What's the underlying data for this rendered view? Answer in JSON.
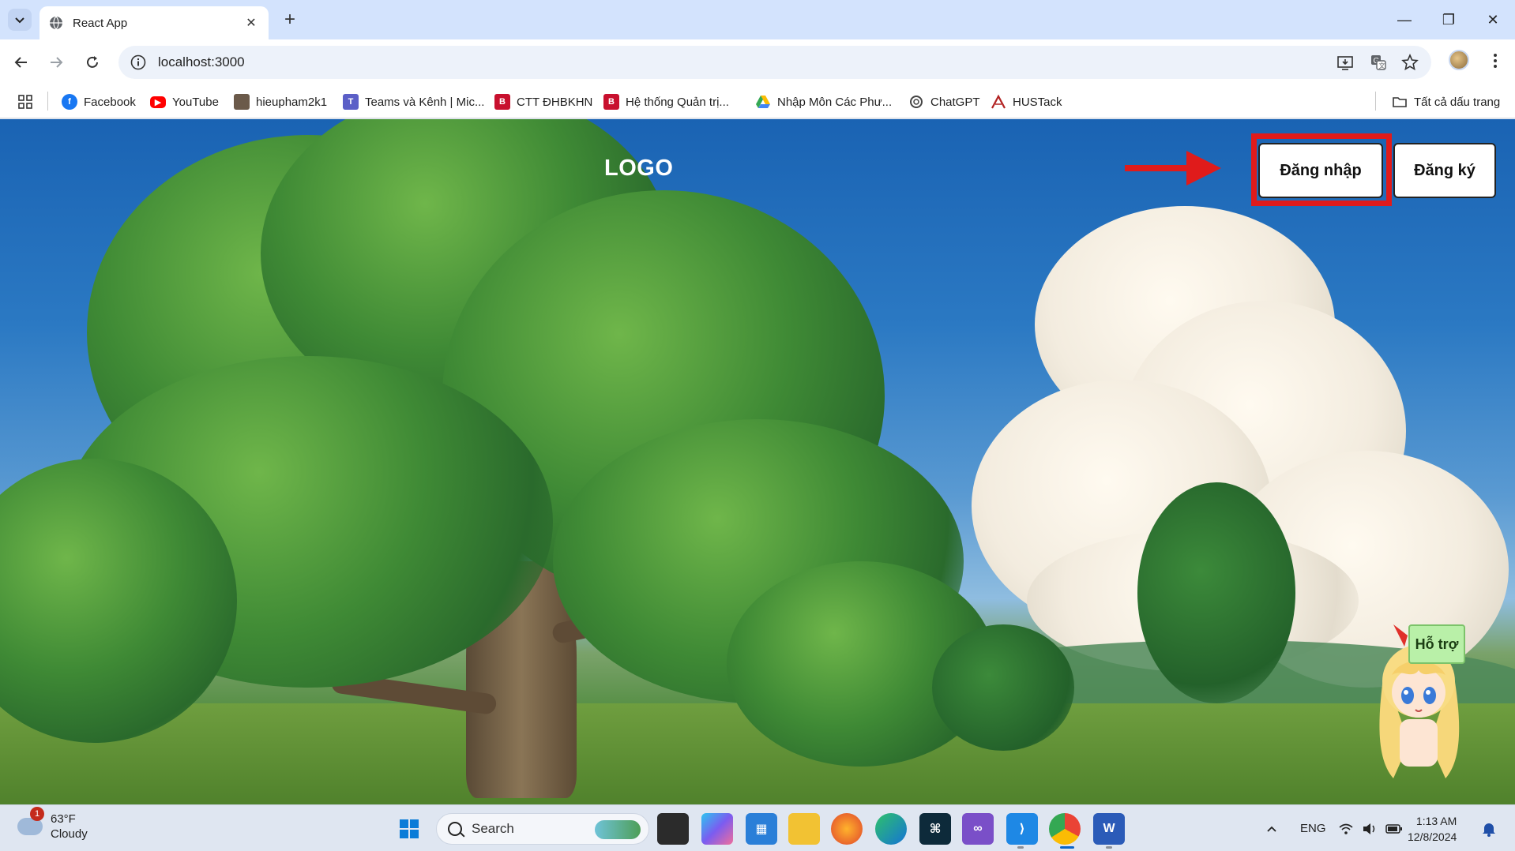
{
  "browser": {
    "tab_title": "React App",
    "tab_close": "✕",
    "new_tab": "+",
    "url": "localhost:3000",
    "window_controls": {
      "minimize": "—",
      "restore": "❐",
      "close": "✕"
    }
  },
  "bookmarks": [
    {
      "label": "Facebook",
      "icon": "facebook-icon",
      "color": "#1877f2"
    },
    {
      "label": "YouTube",
      "icon": "youtube-icon",
      "color": "#ff0000"
    },
    {
      "label": "hieupham2k1",
      "icon": "image-icon",
      "color": "#6b5a4a"
    },
    {
      "label": "Teams và Kênh | Mic...",
      "icon": "teams-icon",
      "color": "#5b5fc7"
    },
    {
      "label": "CTT ĐHBKHN",
      "icon": "hust-icon",
      "color": "#c8102e"
    },
    {
      "label": "Hệ thống Quản trị...",
      "icon": "hust-icon",
      "color": "#c8102e"
    },
    {
      "label": "Nhập Môn Các Phư...",
      "icon": "drive-icon",
      "color": "#34a853"
    },
    {
      "label": "ChatGPT",
      "icon": "chatgpt-icon",
      "color": "#444444"
    },
    {
      "label": "HUSTack",
      "icon": "hustack-icon",
      "color": "#b22222"
    }
  ],
  "all_bookmarks": "Tất cả dấu trang",
  "page": {
    "logo": "LOGO",
    "login_button": "Đăng nhập",
    "register_button": "Đăng ký",
    "support_badge": "Hỗ trợ",
    "accent_color": "#e01b1b"
  },
  "taskbar": {
    "weather_temp": "63°F",
    "weather_desc": "Cloudy",
    "weather_badge": "1",
    "search_placeholder": "Search",
    "language": "ENG",
    "time": "1:13 AM",
    "date": "12/8/2024"
  }
}
